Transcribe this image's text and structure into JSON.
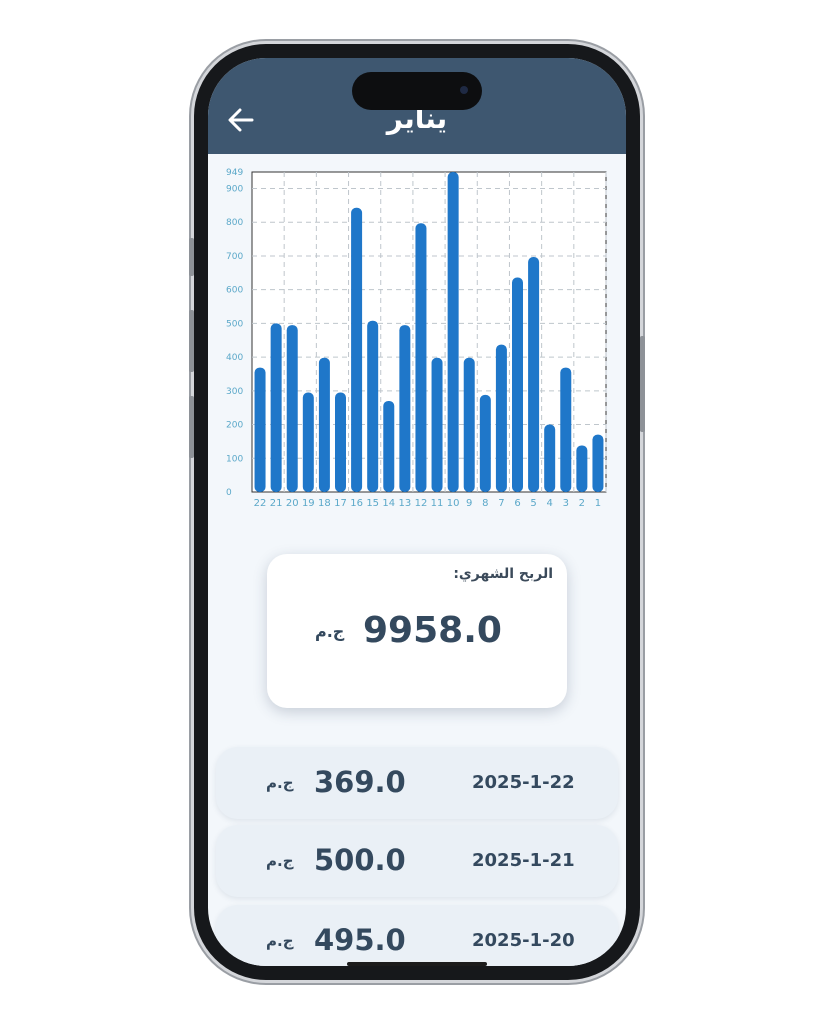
{
  "header": {
    "title": "يناير",
    "back_icon": "arrow-left-icon"
  },
  "chart_data": {
    "type": "bar",
    "categories": [
      "22",
      "21",
      "20",
      "19",
      "18",
      "17",
      "16",
      "15",
      "14",
      "13",
      "12",
      "11",
      "10",
      "9",
      "8",
      "7",
      "6",
      "5",
      "4",
      "3",
      "2",
      "1"
    ],
    "values": [
      369,
      500,
      495,
      295,
      398,
      295,
      843,
      508,
      270,
      495,
      797,
      398,
      949,
      398,
      288,
      437,
      636,
      697,
      200,
      369,
      138,
      170
    ],
    "y_ticks": [
      "0",
      "100",
      "200",
      "300",
      "400",
      "500",
      "600",
      "700",
      "800",
      "900",
      "949"
    ],
    "ylim": [
      0,
      949
    ],
    "grid": true,
    "bar_color": "#1f77c9",
    "title": "",
    "xlabel": "",
    "ylabel": ""
  },
  "summary": {
    "label": "الربح الشهري:",
    "value": "9958.0",
    "currency": "ج.م"
  },
  "transactions": [
    {
      "date": "2025-1-22",
      "amount": "369.0",
      "currency": "ج.م"
    },
    {
      "date": "2025-1-21",
      "amount": "500.0",
      "currency": "ج.م"
    },
    {
      "date": "2025-1-20",
      "amount": "495.0",
      "currency": "ج.م"
    }
  ],
  "colors": {
    "header_bg": "#3e5770",
    "screen_bg": "#f3f7fb",
    "text_dark": "#34495e",
    "axis_text": "#5ba8c9"
  }
}
